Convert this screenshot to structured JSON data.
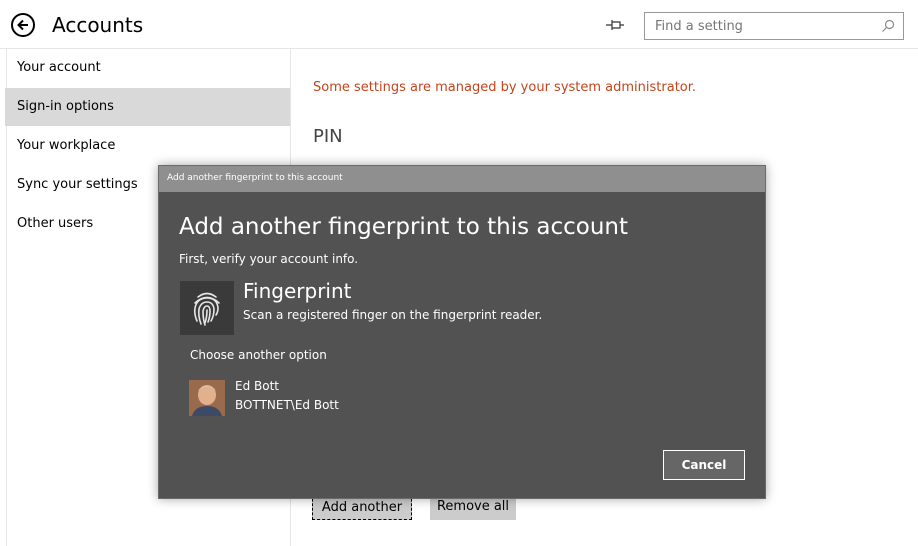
{
  "header": {
    "title": "Accounts",
    "search_placeholder": "Find a setting"
  },
  "sidebar": {
    "items": [
      {
        "label": "Your account"
      },
      {
        "label": "Sign-in options",
        "selected": true
      },
      {
        "label": "Your workplace"
      },
      {
        "label": "Sync your settings"
      },
      {
        "label": "Other users"
      }
    ]
  },
  "main": {
    "admin_notice": "Some settings are managed by your system administrator.",
    "section_title": "PIN",
    "add_another_label": "Add another",
    "remove_all_label": "Remove all"
  },
  "dialog": {
    "window_title": "Add another fingerprint to this account",
    "heading": "Add another fingerprint to this account",
    "subheading": "First, verify your account info.",
    "method_title": "Fingerprint",
    "method_description": "Scan a registered finger on the fingerprint reader.",
    "choose_another": "Choose another option",
    "user_name": "Ed Bott",
    "user_account": "BOTTNET\\Ed Bott",
    "cancel_label": "Cancel"
  },
  "colors": {
    "admin_notice": "#c4441c",
    "dialog_bg": "#525252",
    "dialog_titlebar": "#8f8f8f",
    "selected_nav": "#d9d9d9"
  }
}
